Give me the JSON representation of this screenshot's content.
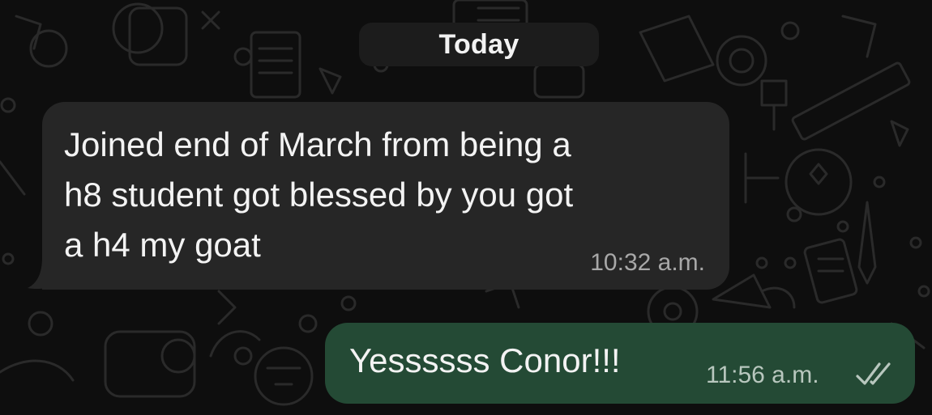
{
  "date_separator": {
    "label": "Today"
  },
  "messages": [
    {
      "direction": "incoming",
      "text": "Joined end of March from being a\nh8 student got blessed by you got\na h4 my goat",
      "time": "10:32 a.m."
    },
    {
      "direction": "outgoing",
      "text": "Yessssss Conor!!!",
      "time": "11:56 a.m.",
      "status_icon": "double-check-icon"
    }
  ],
  "colors": {
    "background": "#0e0e0e",
    "incoming_bubble": "#262626",
    "outgoing_bubble": "#244a35",
    "date_chip": "#1c1c1c",
    "timestamp": "#a8a8a8"
  }
}
